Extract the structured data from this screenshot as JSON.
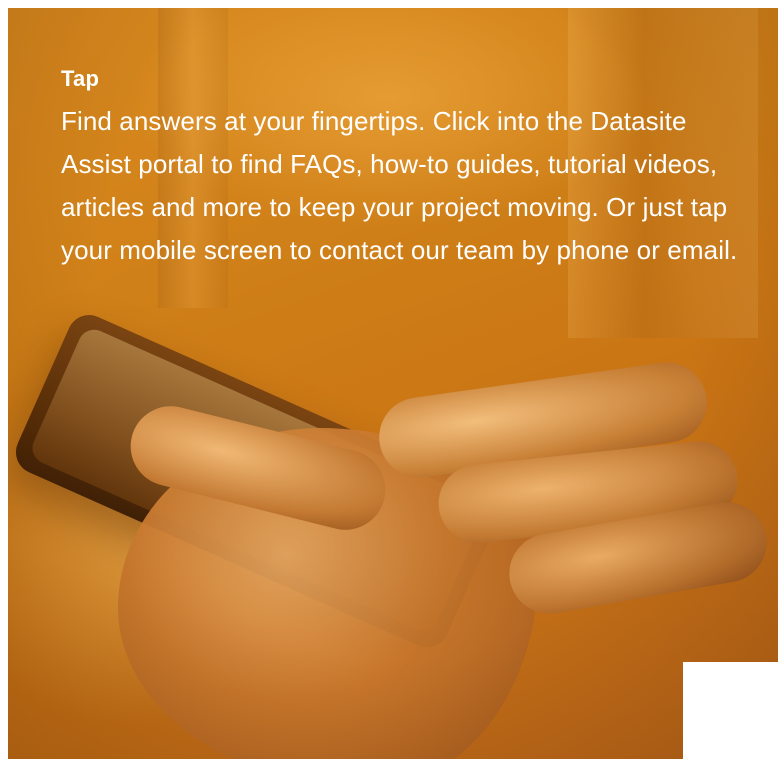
{
  "card": {
    "heading": "Tap",
    "body": "Find answers at your fingertips. Click into the Datasite Assist portal to find FAQs, how-to guides, tutorial videos, articles and more to keep your project moving. Or just tap your mobile screen to contact our team by phone or email."
  },
  "colors": {
    "overlay_orange": "#d98a1f",
    "text": "#ffffff",
    "background": "#ffffff"
  },
  "image": {
    "subject": "hands-holding-smartphone-photo"
  }
}
